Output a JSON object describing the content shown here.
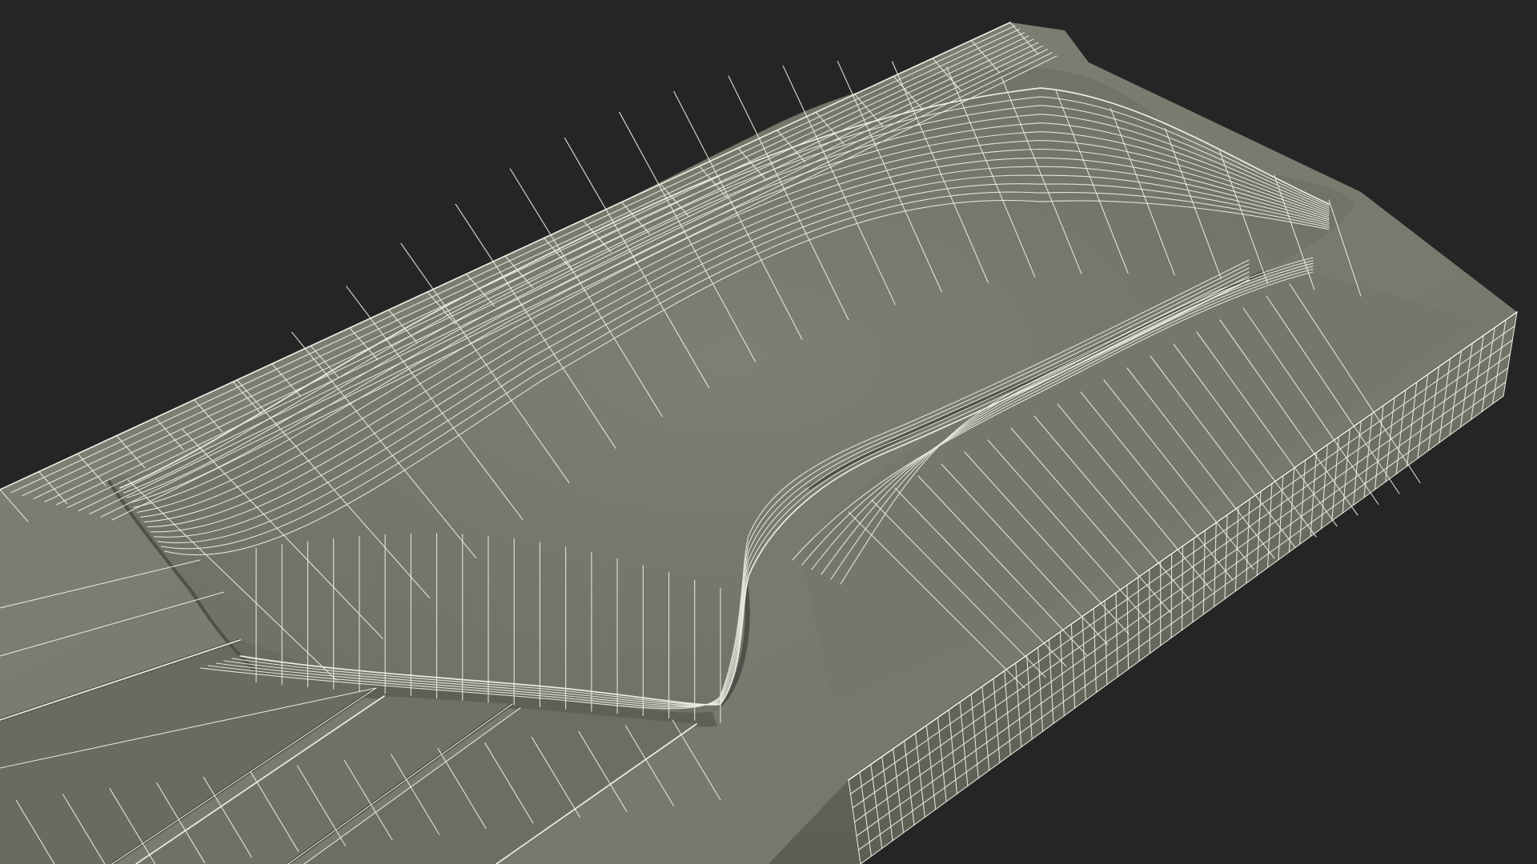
{
  "scene": {
    "background_color": "#252525",
    "surface_color": "#7b7c70",
    "surface_shade_color": "#666759",
    "surface_dark_color": "#55564b",
    "wire_color": "#ecece3",
    "render_mode": "wireframe-on-shaded"
  }
}
